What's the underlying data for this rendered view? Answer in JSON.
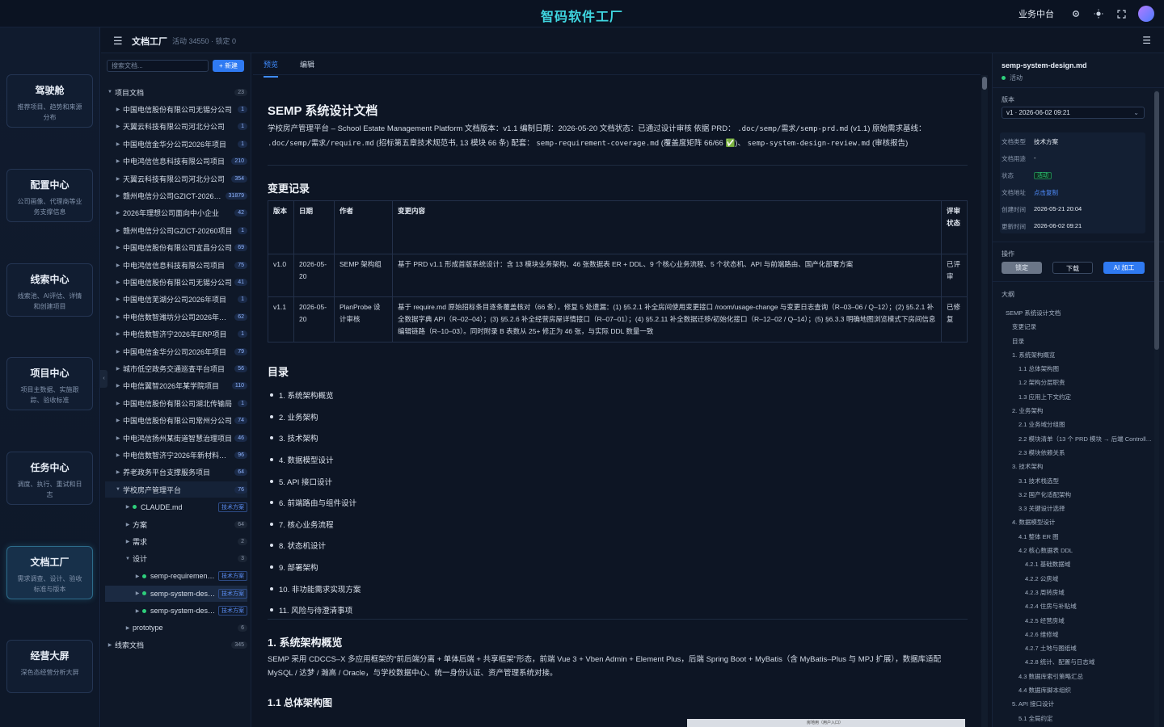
{
  "app": {
    "brand": "智码软件工厂",
    "top_link": "业务中台"
  },
  "topbar_icons": [
    "settings-icon",
    "theme-icon",
    "fullscreen-icon"
  ],
  "nav": [
    {
      "title": "驾驶舱",
      "desc": "推荐项目、趋势和来源分布"
    },
    {
      "title": "配置中心",
      "desc": "公司画像、代理商等业务支撑信息"
    },
    {
      "title": "线索中心",
      "desc": "线索池、AI评估、详情和创建项目"
    },
    {
      "title": "项目中心",
      "desc": "项目主数据、实施跟踪、验收标准"
    },
    {
      "title": "任务中心",
      "desc": "调度、执行、重试和日志"
    },
    {
      "title": "文档工厂",
      "desc": "需求调查、设计、验收标准与版本"
    },
    {
      "title": "经营大屏",
      "desc": "深色态经营分析大屏"
    }
  ],
  "subheader": {
    "title": "文档工厂",
    "meta": "活动 34550 · 锁定 0"
  },
  "tree": {
    "search_placeholder": "搜索文档...",
    "new_label": "+ 新建",
    "root": {
      "label": "项目文档",
      "count": "23"
    },
    "items": [
      {
        "label": "中国电信股份有限公司无锡分公司",
        "count": "1"
      },
      {
        "label": "天翼云科技有限公司河北分公司",
        "count": "1"
      },
      {
        "label": "中国电信金华分公司2026年项目",
        "count": "1"
      },
      {
        "label": "中电鸿信信息科技有限公司项目",
        "count": "210"
      },
      {
        "label": "天翼云科技有限公司河北分公司",
        "count": "354"
      },
      {
        "label": "赣州电信分公司GZICT-2026项目",
        "count": "31879"
      },
      {
        "label": "2026年理想公司面向中小企业",
        "count": "42"
      },
      {
        "label": "赣州电信分公司GZICT-20260项目",
        "count": "1"
      },
      {
        "label": "中国电信股份有限公司宜昌分公司",
        "count": "69"
      },
      {
        "label": "中电鸿信信息科技有限公司项目",
        "count": "75"
      },
      {
        "label": "中国电信股份有限公司无锡分公司",
        "count": "41"
      },
      {
        "label": "中国电信芜湖分公司2026年项目",
        "count": "1"
      },
      {
        "label": "中电信数智潍坊分公司2026年项目",
        "count": "62"
      },
      {
        "label": "中电信数智济宁2026年ERP项目",
        "count": "1"
      },
      {
        "label": "中国电信金华分公司2026年项目",
        "count": "79"
      },
      {
        "label": "城市低空政务交通巡查平台项目",
        "count": "56"
      },
      {
        "label": "中电信翼智2026年某学院项目",
        "count": "110"
      },
      {
        "label": "中国电信股份有限公司湖北传输局",
        "count": "1"
      },
      {
        "label": "中国电信股份有限公司常州分公司",
        "count": "74"
      },
      {
        "label": "中电鸿信扬州某街道智慧治理项目",
        "count": "46"
      },
      {
        "label": "中电信数智济宁2026年新材料项目",
        "count": "96"
      },
      {
        "label": "养老政务平台支撑服务项目",
        "count": "64"
      }
    ],
    "open_group": {
      "label": "学校房产管理平台",
      "count": "76"
    },
    "children": [
      {
        "label": "CLAUDE.md",
        "tag": "技术方案"
      },
      {
        "label": "方案",
        "count": "64"
      },
      {
        "label": "需求",
        "count": "2"
      },
      {
        "label": "设计",
        "count": "3"
      }
    ],
    "design_files": [
      {
        "label": "semp-requirement-coverage.md",
        "tag": "技术方案"
      },
      {
        "label": "semp-system-design.md",
        "tag": "技术方案"
      },
      {
        "label": "semp-system-design-review.md",
        "tag": "技术方案"
      }
    ],
    "prototype": {
      "label": "prototype",
      "count": "6"
    },
    "root2": {
      "label": "线索文档",
      "count": "345"
    }
  },
  "tabs": {
    "preview": "预览",
    "edit": "编辑"
  },
  "doc": {
    "title": "SEMP 系统设计文档",
    "intro_1": "学校房产管理平台 – School Estate Management Platform 文档版本：v1.1 编制日期：2026-05-20 文档状态：已通过设计审核 依据 PRD：",
    "intro_code_1": ".doc/semp/需求/semp-prd.md",
    "intro_2": "(v1.1)  原始需求基线：",
    "intro_code_2": ".doc/semp/需求/require.md",
    "intro_3": "(招标第五章技术规范书, 13 模块 66 条)  配套：",
    "intro_code_3": "semp-requirement-coverage.md",
    "intro_4": "(覆盖度矩阵 66/66 ✅)、",
    "intro_code_4": "semp-system-design-review.md",
    "intro_5": "(审核报告)",
    "change_heading": "变更记录",
    "change_headers": [
      "版本",
      "日期",
      "作者",
      "变更内容",
      "评审状态"
    ],
    "change_rows": [
      {
        "ver": "v1.0",
        "date": "2026-05-20",
        "author": "SEMP 架构组",
        "content": "基于 PRD v1.1 形成首版系统设计：含 13 模块业务架构、46 张数据表 ER + DDL、9 个核心业务流程、5 个状态机、API 与前端路由、国产化部署方案",
        "status": "已评审"
      },
      {
        "ver": "v1.1",
        "date": "2026-05-20",
        "author": "PlanProbe 设计审核",
        "content": "基于 require.md 原始招标条目逐条覆盖核对（66 条），修复 5 处遗漏：(1) §5.2.1 补全房间使用变更接口 /room/usage-change 与变更日志查询（R–03–06 / Q–12）；(2) §5.2.1 补全数据字典 API（R–02–04）；(3) §5.2.6 补全经营房屋详情接口（R–07–01）；(4) §5.2.11 补全数据迁移/初始化接口（R–12–02 / Q–14）；(5) §6.3.3 明确地图浏览模式下房间信息编辑链路（R–10–03）。同时附录 B 表数从 25+ 修正为 46 张，与实际 DDL 数量一致",
        "status": "已修复"
      }
    ],
    "toc_heading": "目录",
    "toc": [
      "1. 系统架构概览",
      "2. 业务架构",
      "3. 技术架构",
      "4. 数据模型设计",
      "5. API 接口设计",
      "6. 前端路由与组件设计",
      "7. 核心业务流程",
      "8. 状态机设计",
      "9. 部署架构",
      "10. 非功能需求实现方案",
      "11. 风险与待澄清事项"
    ],
    "sec1_heading": "1. 系统架构概览",
    "sec1_text": "SEMP 采用 CDCCS–X 多应用框架的\"前后端分离 + 单体后端 + 共享框架\"形态，前端 Vue 3 + Vben Admin + Element Plus，后端 Spring Boot + MyBatis（含 MyBatis–Plus 与 MPJ 扩展），数据库适配 MySQL / 达梦 / 瀚高 / Oracle，与学校数据中心、统一身份认证、资产管理系统对接。",
    "sec11_heading": "1.1 总体架构图",
    "diagram_label": "房地用（用户入口）"
  },
  "info": {
    "file_name": "semp-system-design.md",
    "file_status": "活动",
    "version_label": "版本",
    "version_value": "v1 · 2026-06-02 09:21",
    "meta": [
      {
        "k": "文档类型",
        "v": "技术方案"
      },
      {
        "k": "文档用途",
        "v": "-"
      },
      {
        "k": "状态",
        "v": "活动"
      },
      {
        "k": "文档地址",
        "v": "点击复制"
      },
      {
        "k": "创建时间",
        "v": "2026-05-21 20:04"
      },
      {
        "k": "更新时间",
        "v": "2026-06-02 09:21"
      }
    ],
    "ops_label": "操作",
    "btn_lock": "锁定",
    "btn_download": "下载",
    "btn_ai": "AI 加工",
    "outline_label": "大纲",
    "outline": [
      {
        "t": "SEMP 系统设计文档",
        "l": 1
      },
      {
        "t": "变更记录",
        "l": 2
      },
      {
        "t": "目录",
        "l": 2
      },
      {
        "t": "1. 系统架构概览",
        "l": 2
      },
      {
        "t": "1.1 总体架构图",
        "l": 3
      },
      {
        "t": "1.2 架构分层职责",
        "l": 3
      },
      {
        "t": "1.3 应用上下文约定",
        "l": 3
      },
      {
        "t": "2. 业务架构",
        "l": 2
      },
      {
        "t": "2.1 业务域分组图",
        "l": 3
      },
      {
        "t": "2.2 模块清单（13 个 PRD 模块 → 后端 Controller 映射）",
        "l": 3
      },
      {
        "t": "2.3 模块依赖关系",
        "l": 3
      },
      {
        "t": "3. 技术架构",
        "l": 2
      },
      {
        "t": "3.1 技术栈选型",
        "l": 3
      },
      {
        "t": "3.2 国产化适配架构",
        "l": 3
      },
      {
        "t": "3.3 关键设计选择",
        "l": 3
      },
      {
        "t": "4. 数据模型设计",
        "l": 2
      },
      {
        "t": "4.1 整体 ER 图",
        "l": 3
      },
      {
        "t": "4.2 核心数据表 DDL",
        "l": 3
      },
      {
        "t": "4.2.1 基础数据域",
        "l": 4
      },
      {
        "t": "4.2.2 公房域",
        "l": 4
      },
      {
        "t": "4.2.3 周转房域",
        "l": 4
      },
      {
        "t": "4.2.4 住房与补贴域",
        "l": 4
      },
      {
        "t": "4.2.5 经营房域",
        "l": 4
      },
      {
        "t": "4.2.6 维修域",
        "l": 4
      },
      {
        "t": "4.2.7 土地与图纸域",
        "l": 4
      },
      {
        "t": "4.2.8 统计、配置与日志域",
        "l": 4
      },
      {
        "t": "4.3 数据库索引策略汇总",
        "l": 3
      },
      {
        "t": "4.4 数据库脚本组织",
        "l": 3
      },
      {
        "t": "5. API 接口设计",
        "l": 2
      },
      {
        "t": "5.1 全局约定",
        "l": 3
      }
    ]
  }
}
